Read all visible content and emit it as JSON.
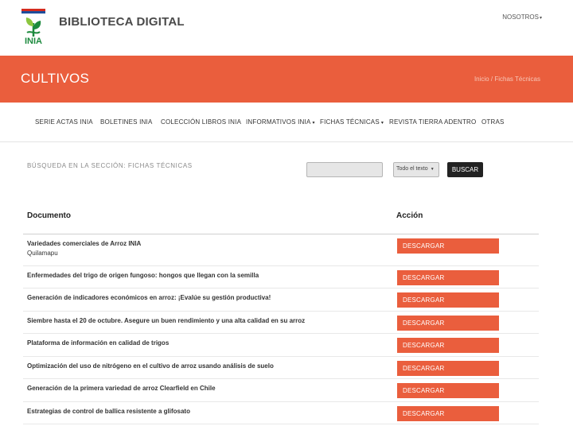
{
  "header": {
    "logo_text": "INIA",
    "site_title": "BIBLIOTECA DIGITAL",
    "nosotros_label": "NOSOTROS"
  },
  "banner": {
    "title": "CULTIVOS",
    "breadcrumb_home": "Inicio",
    "breadcrumb_sep": "/",
    "breadcrumb_current": "Fichas Técnicas"
  },
  "nav": {
    "items": [
      {
        "label": "SERIE ACTAS INIA",
        "dropdown": false
      },
      {
        "label": "BOLETINES INIA",
        "dropdown": false
      },
      {
        "label": "COLECCIÓN LIBROS INIA",
        "dropdown": false
      },
      {
        "label": "INFORMATIVOS INIA",
        "dropdown": true
      },
      {
        "label": "FICHAS TÉCNICAS",
        "dropdown": true
      },
      {
        "label": "REVISTA TIERRA ADENTRO",
        "dropdown": false
      },
      {
        "label": "OTRAS",
        "dropdown": false
      }
    ]
  },
  "search": {
    "label": "BÚSQUEDA EN LA SECCIÓN: FICHAS TÉCNICAS",
    "input_value": "",
    "select_value": "Todo el texto",
    "button_label": "BUSCAR"
  },
  "table": {
    "col_document": "Documento",
    "col_action": "Acción",
    "download_label": "DESCARGAR",
    "rows": [
      {
        "title": "Variedades comerciales de Arroz INIA",
        "subtitle": "Quilamapu"
      },
      {
        "title": "Enfermedades del trigo de origen fungoso: hongos que llegan con la semilla",
        "subtitle": ""
      },
      {
        "title": "Generación de indicadores económicos en arroz: ¡Evalúe su gestión productiva!",
        "subtitle": ""
      },
      {
        "title": "Siembre hasta el 20 de octubre. Asegure un buen rendimiento y una alta calidad en su arroz",
        "subtitle": ""
      },
      {
        "title": "Plataforma de información en calidad de trigos",
        "subtitle": ""
      },
      {
        "title": "Optimización del uso de nitrógeno en el cultivo de arroz usando análisis de suelo",
        "subtitle": ""
      },
      {
        "title": "Generación de la primera variedad de arroz Clearfield en Chile",
        "subtitle": ""
      },
      {
        "title": "Estrategias de control de ballica resistente a glifosato",
        "subtitle": ""
      }
    ]
  },
  "colors": {
    "accent": "#ea5e3d",
    "dark_button": "#222222",
    "logo_green": "#1d8a3e"
  }
}
